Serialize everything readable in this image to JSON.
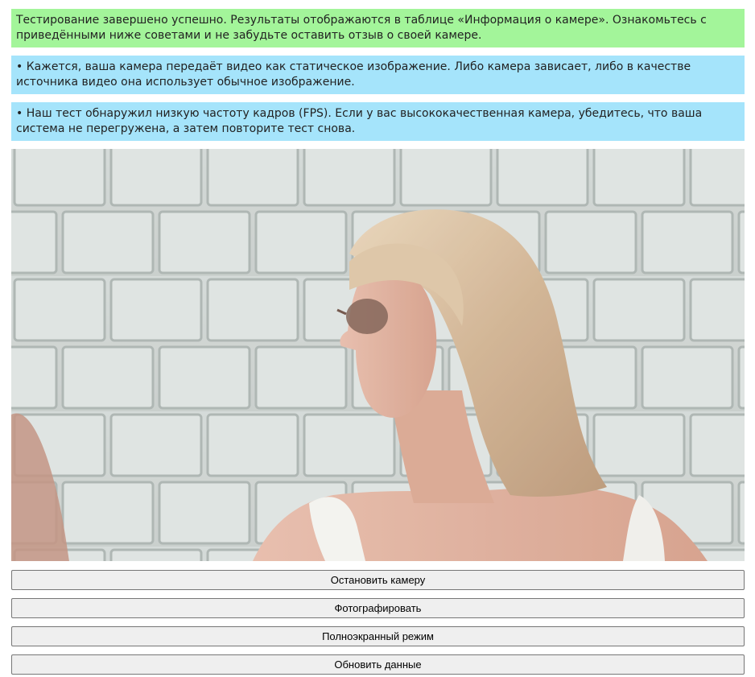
{
  "messages": {
    "success": "Тестирование завершено успешно. Результаты отображаются в таблице «Информация о камере». Ознакомьтесь с приведёнными ниже советами и не забудьте оставить отзыв о своей камере.",
    "tip_static": "• Кажется, ваша камера передаёт видео как статическое изображение. Либо камера зависает, либо в качестве источника видео она использует обычное изображение.",
    "tip_fps": "• Наш тест обнаружил низкую частоту кадров (FPS). Если у вас высококачественная камера, убедитесь, что ваша система не перегружена, а затем повторите тест снова."
  },
  "colors": {
    "success_bg": "#a3f59a",
    "info_bg": "#a5e4fb"
  },
  "buttons": {
    "stop_camera": "Остановить камеру",
    "take_photo": "Фотографировать",
    "fullscreen": "Полноэкранный режим",
    "refresh": "Обновить данные"
  }
}
